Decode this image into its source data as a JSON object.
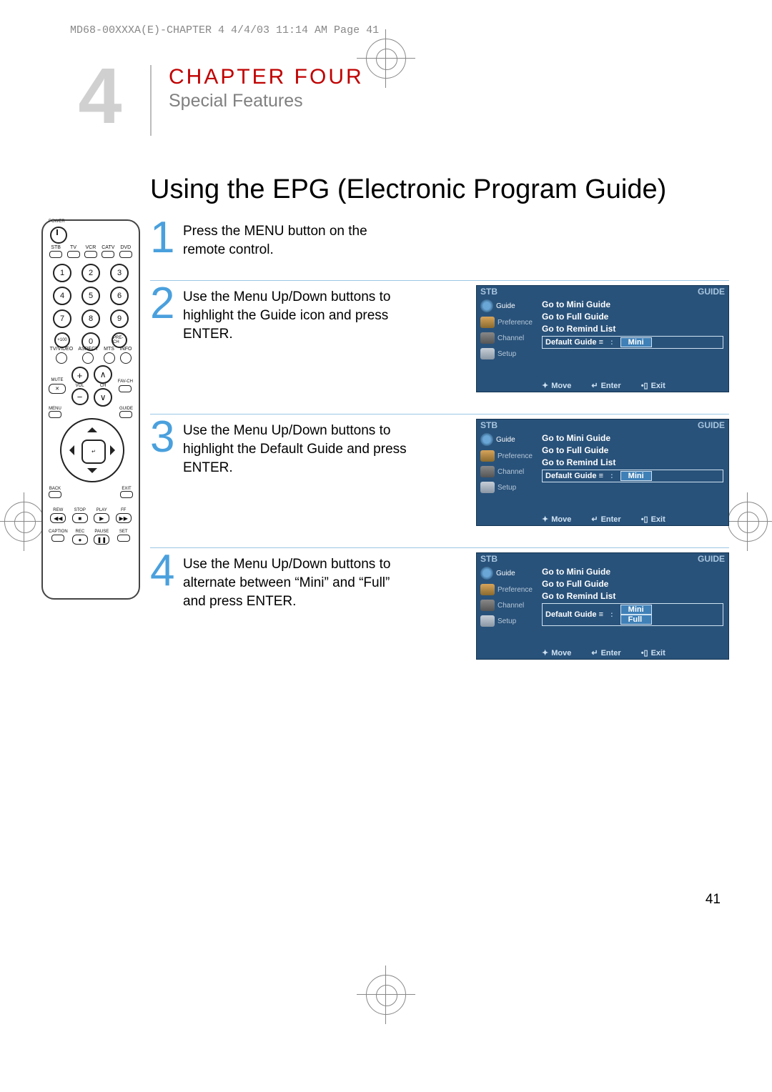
{
  "meta": {
    "header": "MD68-00XXXA(E)-CHAPTER 4  4/4/03  11:14 AM  Page 41"
  },
  "banner": {
    "number": "4",
    "chapter_label": "CHAPTER FOUR",
    "subtitle": "Special Features"
  },
  "section_title": "Using the EPG (Electronic Program Guide)",
  "steps": [
    {
      "num": "1",
      "text": "Press the MENU button on the remote control."
    },
    {
      "num": "2",
      "text": "Use the Menu Up/Down buttons to highlight the Guide icon and press ENTER."
    },
    {
      "num": "3",
      "text": "Use the Menu Up/Down buttons to highlight the Default Guide and press ENTER."
    },
    {
      "num": "4",
      "text": "Use the Menu Up/Down buttons to alternate between “Mini” and “Full” and press ENTER."
    }
  ],
  "osd": {
    "title_left": "STB",
    "title_right": "GUIDE",
    "side": [
      {
        "label": "Guide",
        "selected": true
      },
      {
        "label": "Preference"
      },
      {
        "label": "Channel"
      },
      {
        "label": "Setup"
      }
    ],
    "lines": {
      "l1": "Go to Mini Guide",
      "l2": "Go to Full Guide",
      "l3": "Go to Remind List",
      "default_label": "Default Guide",
      "colon": ":",
      "val_mini": "Mini",
      "val_full": "Full"
    },
    "footer": {
      "move": "Move",
      "enter": "Enter",
      "exit": "Exit"
    }
  },
  "remote": {
    "power": "POWER",
    "sources": [
      "STB",
      "TV",
      "VCR",
      "CATV",
      "DVD"
    ],
    "numbers": [
      "1",
      "2",
      "3",
      "4",
      "5",
      "6",
      "7",
      "8",
      "9"
    ],
    "plus100": "+100",
    "zero": "0",
    "prech": "PRE-CH",
    "row2": [
      "TV/VIDEO",
      "ASPECT",
      "MTS",
      "INFO"
    ],
    "mute": "MUTE",
    "vol": "VOL",
    "ch": "CH",
    "favch": "FAV-CH",
    "menu": "MENU",
    "guide": "GUIDE",
    "enter": "↵",
    "back": "BACK",
    "exit": "EXIT",
    "transport": [
      "REW",
      "STOP",
      "PLAY",
      "FF"
    ],
    "tsym": [
      "◀◀",
      "■",
      "▶",
      "▶▶"
    ],
    "transport2": [
      "CAPTION",
      "REC",
      "PAUSE",
      "SET"
    ],
    "t2sym": [
      "",
      "●",
      "❚❚",
      ""
    ]
  },
  "page_number": "41"
}
